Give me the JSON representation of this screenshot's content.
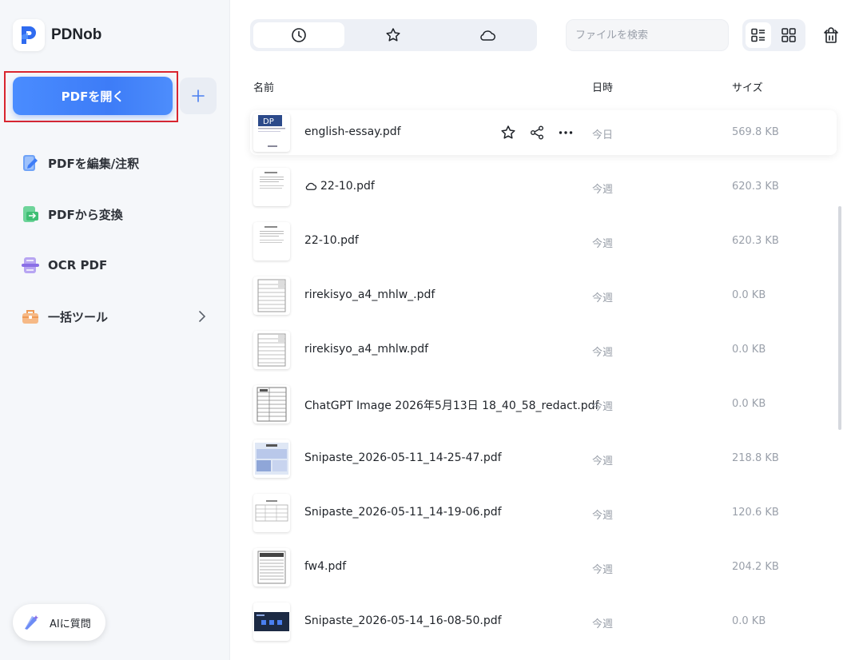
{
  "app": {
    "name": "PDNob"
  },
  "sidebar": {
    "open_button": "PDFを開く",
    "items": [
      {
        "label": "PDFを編集/注釈",
        "icon": "edit-icon"
      },
      {
        "label": "PDFから変換",
        "icon": "convert-icon"
      },
      {
        "label": "OCR PDF",
        "icon": "ocr-icon"
      },
      {
        "label": "一括ツール",
        "icon": "toolbox-icon"
      }
    ],
    "ai_button": "AIに質問"
  },
  "toolbar": {
    "tabs": [
      {
        "icon": "clock-icon",
        "active": true
      },
      {
        "icon": "star-icon",
        "active": false
      },
      {
        "icon": "cloud-icon",
        "active": false
      }
    ],
    "search_placeholder": "ファイルを検索",
    "view": "list"
  },
  "columns": {
    "name": "名前",
    "date": "日時",
    "size": "サイズ"
  },
  "files": [
    {
      "name": "english-essay.pdf",
      "date": "今日",
      "size": "569.8 KB",
      "cloud": false,
      "highlighted": true
    },
    {
      "name": "22-10.pdf",
      "date": "今週",
      "size": "620.3 KB",
      "cloud": true,
      "highlighted": false
    },
    {
      "name": "22-10.pdf",
      "date": "今週",
      "size": "620.3 KB",
      "cloud": false,
      "highlighted": false
    },
    {
      "name": "rirekisyo_a4_mhlw_.pdf",
      "date": "今週",
      "size": "0.0 KB",
      "cloud": false,
      "highlighted": false
    },
    {
      "name": "rirekisyo_a4_mhlw.pdf",
      "date": "今週",
      "size": "0.0 KB",
      "cloud": false,
      "highlighted": false
    },
    {
      "name": "ChatGPT Image 2026年5月13日 18_40_58_redact.pdf",
      "date": "今週",
      "size": "0.0 KB",
      "cloud": false,
      "highlighted": false
    },
    {
      "name": "Snipaste_2026-05-11_14-25-47.pdf",
      "date": "今週",
      "size": "218.8 KB",
      "cloud": false,
      "highlighted": false
    },
    {
      "name": "Snipaste_2026-05-11_14-19-06.pdf",
      "date": "今週",
      "size": "120.6 KB",
      "cloud": false,
      "highlighted": false
    },
    {
      "name": "fw4.pdf",
      "date": "今週",
      "size": "204.2 KB",
      "cloud": false,
      "highlighted": false
    },
    {
      "name": "Snipaste_2026-05-14_16-08-50.pdf",
      "date": "今週",
      "size": "0.0 KB",
      "cloud": false,
      "highlighted": false
    }
  ],
  "colors": {
    "accent": "#3d7cf7",
    "highlight_border": "#d9252f"
  }
}
